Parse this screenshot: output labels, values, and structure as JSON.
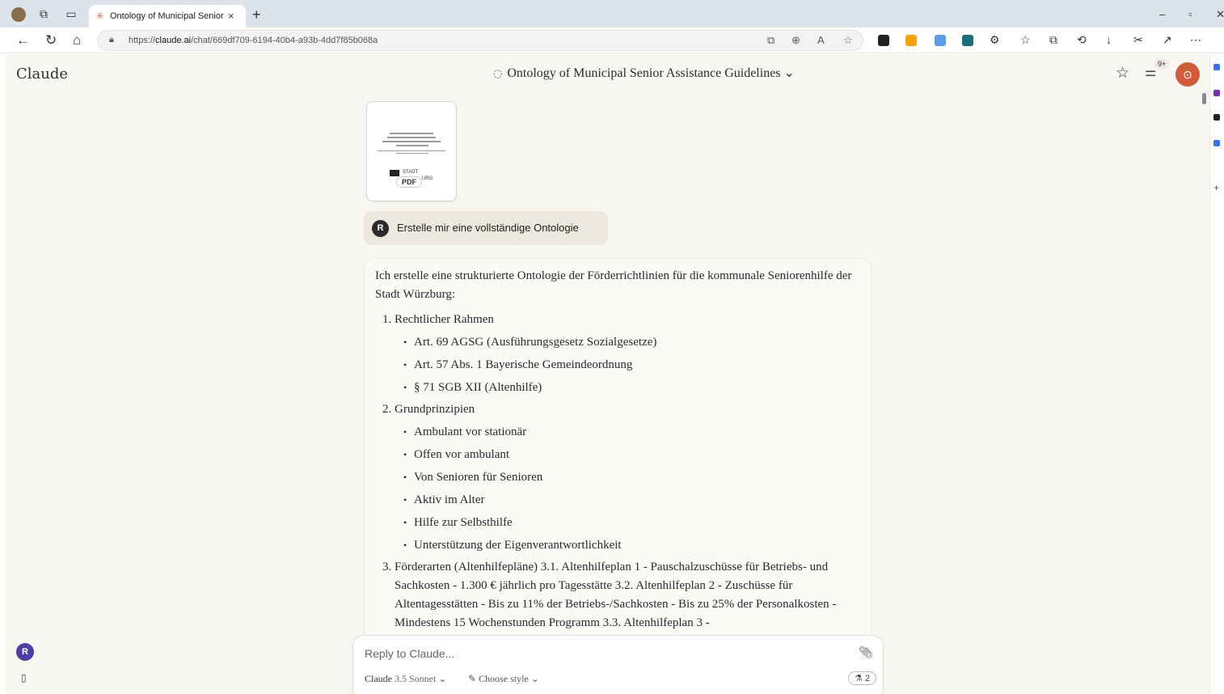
{
  "browser": {
    "tab_title": "Ontology of Municipal Senior Ass",
    "tab_close": "×",
    "new_tab": "+",
    "url_prefix": "https://",
    "url_domain": "claude.ai",
    "url_path": "/chat/669df709-6194-40b4-a93b-4dd7f85b068a",
    "window_controls": [
      "–",
      "▫",
      "✕"
    ]
  },
  "app": {
    "logo": "Claude",
    "chat_title": "Ontology of Municipal Senior Assistance Guidelines",
    "chat_title_chevron": "⌄",
    "badge": "9+",
    "attachment_badge": "PDF",
    "attachment_stadt": "STADT",
    "attachment_trail": "URG",
    "user_initial": "R",
    "user_message": "Erstelle mir eine vollständige Ontologie"
  },
  "response": {
    "intro": "Ich erstelle eine strukturierte Ontologie der Förderrichtlinien für die kommunale Seniorenhilfe der Stadt Würzburg:",
    "sections": [
      {
        "title": "Rechtlicher Rahmen",
        "items": [
          "Art. 69 AGSG (Ausführungsgesetz Sozialgesetze)",
          "Art. 57 Abs. 1 Bayerische Gemeindeordnung",
          "§ 71 SGB XII (Altenhilfe)"
        ]
      },
      {
        "title": "Grundprinzipien",
        "items": [
          "Ambulant vor stationär",
          "Offen vor ambulant",
          "Von Senioren für Senioren",
          "Aktiv im Alter",
          "Hilfe zur Selbsthilfe",
          "Unterstützung der Eigenverantwortlichkeit"
        ]
      }
    ],
    "section3": "Förderarten (Altenhilfepläne) 3.1. Altenhilfeplan 1 - Pauschalzuschüsse für Betriebs- und Sachkosten - 1.300 € jährlich pro Tagesstätte 3.2. Altenhilfeplan 2 - Zuschüsse für Altentagesstätten - Bis zu 11% der Betriebs-/Sachkosten - Bis zu 25% der Personalkosten - Mindestens 15 Wochenstunden Programm 3.3. Altenhilfeplan 3 -"
  },
  "composer": {
    "placeholder": "Reply to Claude...",
    "model_name": "Claude",
    "model_version": "3.5 Sonnet ⌄",
    "style": "Choose style ⌄",
    "count": "2"
  },
  "sidebar": {
    "user_initial": "R"
  }
}
